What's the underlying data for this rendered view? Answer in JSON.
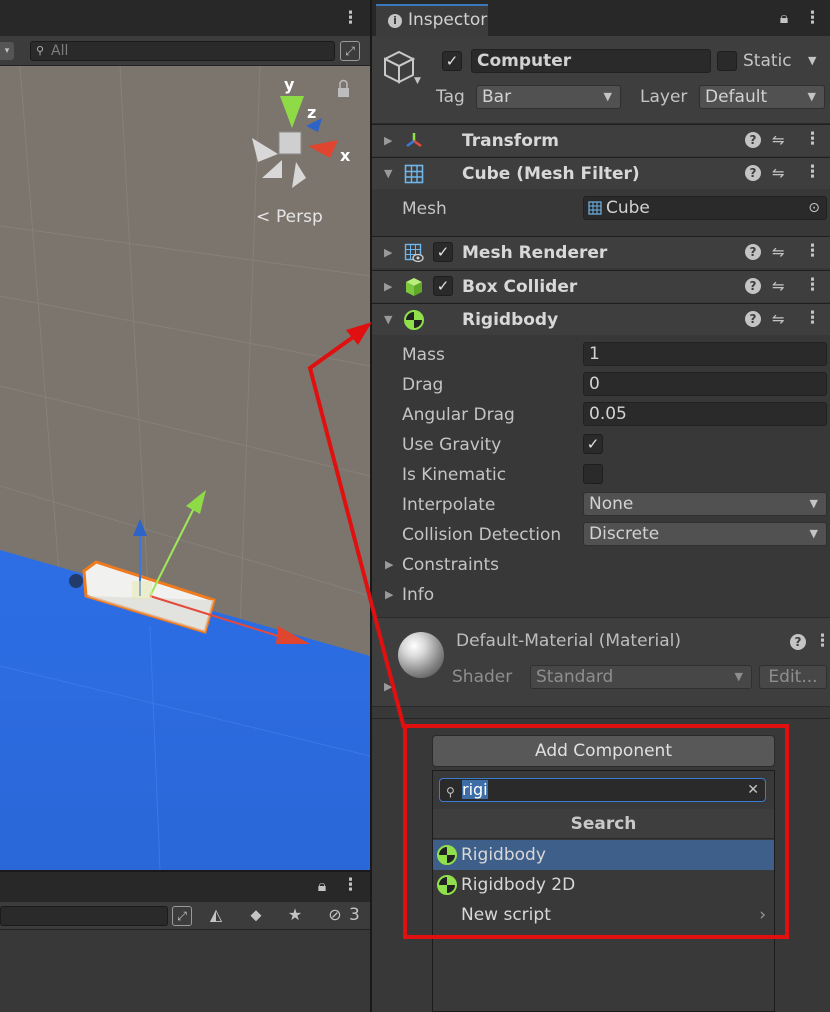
{
  "scene": {
    "search_placeholder": "All",
    "axis_y": "y",
    "axis_z": "z",
    "axis_x": "x",
    "persp_label": "Persp",
    "hidden_count": "3"
  },
  "inspector": {
    "tab_label": "Inspector",
    "object_name": "Computer",
    "object_active": true,
    "static_label": "Static",
    "tag_label": "Tag",
    "tag_value": "Bar",
    "layer_label": "Layer",
    "layer_value": "Default"
  },
  "components": {
    "transform": {
      "name": "Transform"
    },
    "mesh_filter": {
      "name": "Cube (Mesh Filter)",
      "mesh_label": "Mesh",
      "mesh_value": "Cube"
    },
    "mesh_renderer": {
      "name": "Mesh Renderer",
      "enabled": true
    },
    "box_collider": {
      "name": "Box Collider",
      "enabled": true
    },
    "rigidbody": {
      "name": "Rigidbody",
      "mass_label": "Mass",
      "mass": "1",
      "drag_label": "Drag",
      "drag": "0",
      "angular_drag_label": "Angular Drag",
      "angular_drag": "0.05",
      "use_gravity_label": "Use Gravity",
      "use_gravity": true,
      "is_kinematic_label": "Is Kinematic",
      "is_kinematic": false,
      "interpolate_label": "Interpolate",
      "interpolate": "None",
      "collision_label": "Collision Detection",
      "collision": "Discrete",
      "constraints_label": "Constraints",
      "info_label": "Info"
    },
    "material": {
      "name": "Default-Material (Material)",
      "shader_label": "Shader",
      "shader_value": "Standard",
      "edit_label": "Edit..."
    }
  },
  "add_component": {
    "button_label": "Add Component",
    "search_value": "rigi",
    "section_title": "Search",
    "results": [
      {
        "label": "Rigidbody",
        "selected": true
      },
      {
        "label": "Rigidbody 2D",
        "selected": false
      }
    ],
    "new_script_label": "New script"
  },
  "colors": {
    "ground": "#2c6fe0",
    "scene_bg": "#7b756d",
    "highlight_red": "#e01010",
    "selection_blue": "#3e5f8a",
    "rigidbody_green": "#8fe04a"
  }
}
